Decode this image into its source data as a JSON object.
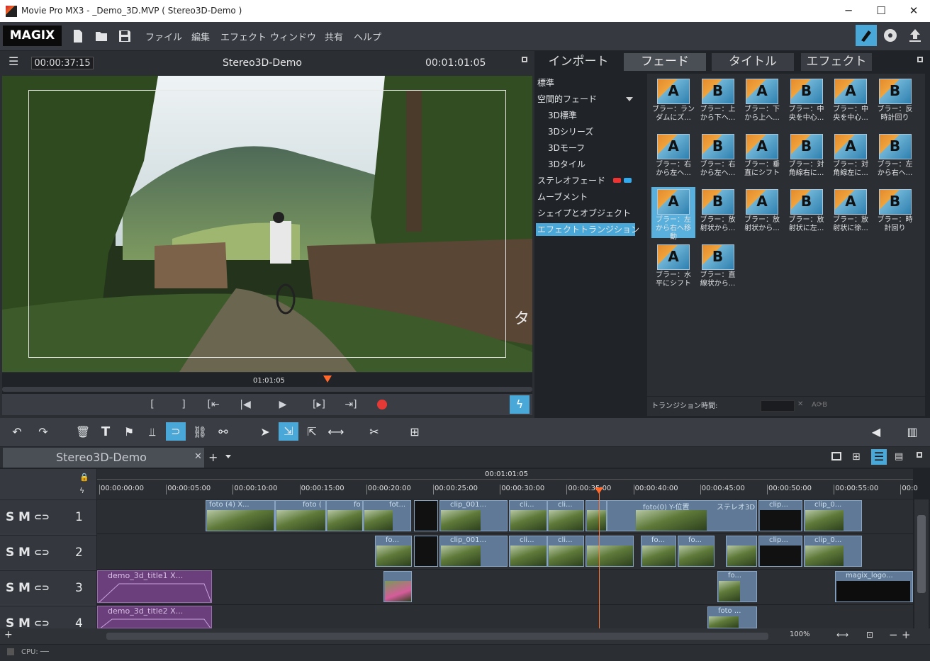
{
  "window": {
    "title": "Movie Pro MX3 - _Demo_3D.MVP ( Stereo3D-Demo )",
    "minimize": "─",
    "maximize": "☐",
    "close": "✕"
  },
  "menubar": {
    "logo": "MAGIX",
    "items": [
      "ファイル",
      "編集",
      "エフェクト",
      "ウィンドウ",
      "共有",
      "ヘルプ"
    ]
  },
  "preview": {
    "timecode_left": "00:00:37:15",
    "title": "Stereo3D-Demo",
    "timecode_right": "00:01:01:05",
    "scrub_time": "01:01:05",
    "overlay_char": "タ"
  },
  "library": {
    "tabs": [
      "インポート",
      "フェード",
      "タイトル",
      "エフェクト"
    ],
    "active_tab": "フェード",
    "tree": [
      {
        "label": "標準",
        "indent": 0
      },
      {
        "label": "空間的フェード",
        "indent": 0,
        "expanded": true
      },
      {
        "label": "3D標準",
        "indent": 1
      },
      {
        "label": "3Dシリーズ",
        "indent": 1
      },
      {
        "label": "3Dモーフ",
        "indent": 1
      },
      {
        "label": "3Dタイル",
        "indent": 1
      },
      {
        "label": "ステレオフェード",
        "indent": 0,
        "badge": "3D glasses"
      },
      {
        "label": "ムーブメント",
        "indent": 0
      },
      {
        "label": "シェイプとオブジェクト",
        "indent": 0
      },
      {
        "label": "エフェクトトランジション",
        "indent": 0,
        "selected": true
      }
    ],
    "thumbnails": [
      {
        "l1": "ブラー：ラン",
        "l2": "ダムにズ..."
      },
      {
        "l1": "ブラー：上",
        "l2": "から下へ..."
      },
      {
        "l1": "ブラー：下",
        "l2": "から上へ..."
      },
      {
        "l1": "ブラー：中",
        "l2": "央を中心..."
      },
      {
        "l1": "ブラー：中",
        "l2": "央を中心..."
      },
      {
        "l1": "ブラー：反",
        "l2": "時計回り"
      },
      {
        "l1": "ブラー：右",
        "l2": "から左へ..."
      },
      {
        "l1": "ブラー：右",
        "l2": "から左へ..."
      },
      {
        "l1": "ブラー：垂",
        "l2": "直にシフト"
      },
      {
        "l1": "ブラー：対",
        "l2": "角線右に..."
      },
      {
        "l1": "ブラー：対",
        "l2": "角線左に..."
      },
      {
        "l1": "ブラー：左",
        "l2": "から右へ..."
      },
      {
        "l1": "ブラー：左",
        "l2": "から右へ移",
        "l3": "動",
        "selected": true
      },
      {
        "l1": "ブラー：放",
        "l2": "射状から..."
      },
      {
        "l1": "ブラー：放",
        "l2": "射状から..."
      },
      {
        "l1": "ブラー：放",
        "l2": "射状に左..."
      },
      {
        "l1": "ブラー：放",
        "l2": "射状に徐..."
      },
      {
        "l1": "ブラー：時",
        "l2": "計回り"
      },
      {
        "l1": "ブラー：水",
        "l2": "平にシフト"
      },
      {
        "l1": "ブラー：直",
        "l2": "線状から..."
      }
    ],
    "transition_duration_label": "トランジション時間:",
    "ab_label": "A⟳B"
  },
  "timeline": {
    "tab_name": "Stereo3D-Demo",
    "ruler_top": "00:01:01:05",
    "ruler_ticks": [
      "00:00:00:00",
      "00:00:05:00",
      "00:00:10:00",
      "00:00:15:00",
      "00:00:20:00",
      "00:00:25:00",
      "00:00:30:00",
      "00:00:35:00",
      "00:00:40:00",
      "00:00:45:00",
      "00:00:50:00",
      "00:00:55:00",
      "00:0"
    ],
    "tracks": [
      {
        "s": "S",
        "m": "M",
        "num": "1"
      },
      {
        "s": "S",
        "m": "M",
        "num": "2"
      },
      {
        "s": "S",
        "m": "M",
        "num": "3"
      },
      {
        "s": "S",
        "m": "M",
        "num": "4"
      }
    ],
    "clips_track1": [
      "foto (4)  X...",
      "foto (",
      "fo",
      "fot...",
      "clip_001...",
      "cli...",
      "cli...",
      "foto(0)  Y-位置",
      "ステレオ3D",
      "clip...",
      "clip_0..."
    ],
    "clips_track2": [
      "fo...",
      "clip_001...",
      "cli...",
      "cli...",
      "fo...",
      "fo...",
      "clip...",
      "clip_0..."
    ],
    "clips_track3": [
      "demo_3d_title1    X...",
      "fo...",
      "magix_logo..."
    ],
    "clips_track4": [
      "demo_3d_title2    X...",
      "foto ..."
    ],
    "zoom": "100%"
  },
  "statusbar": {
    "cpu": "CPU: ──"
  }
}
